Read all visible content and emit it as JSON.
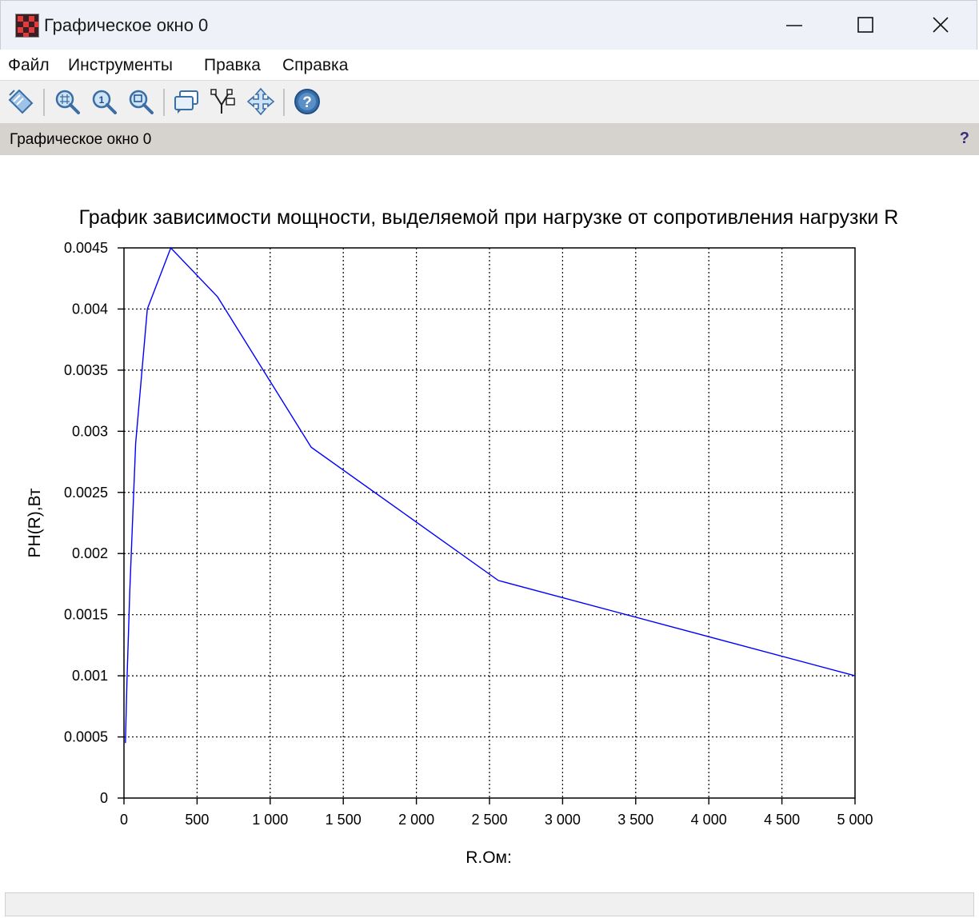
{
  "window": {
    "title": "Графическое окно 0"
  },
  "menu": {
    "items": [
      "Файл",
      "Инструменты",
      "Правка",
      "Справка"
    ]
  },
  "toolbar": {
    "buttons": [
      "datatip-icon",
      "zoom-grid-icon",
      "zoom-100-icon",
      "zoom-area-icon",
      "rotate-icon",
      "datatip-manager-icon",
      "pan-icon",
      "help-icon"
    ]
  },
  "panel": {
    "title": "Графическое окно 0",
    "help": "?"
  },
  "colors": {
    "series": "#0000ff",
    "grid": "#000000",
    "panel": "#d6d3ce",
    "titlebar": "#eef2f8"
  },
  "chart_data": {
    "type": "line",
    "title": "График зависимости мощности, выделяемой при нагрузке от сопротивления нагрузки R",
    "xlabel": "R.Ом:",
    "ylabel": "PH(R),Вт",
    "xlim": [
      0,
      5000
    ],
    "ylim": [
      0,
      0.0045
    ],
    "xticks": [
      0,
      500,
      1000,
      1500,
      2000,
      2500,
      3000,
      3500,
      4000,
      4500,
      5000
    ],
    "xtick_labels": [
      "0",
      "500",
      "1 000",
      "1 500",
      "2 000",
      "2 500",
      "3 000",
      "3 500",
      "4 000",
      "4 500",
      "5 000"
    ],
    "yticks": [
      0,
      0.0005,
      0.001,
      0.0015,
      0.002,
      0.0025,
      0.003,
      0.0035,
      0.004,
      0.0045
    ],
    "ytick_labels": [
      "0",
      "0.0005",
      "0.001",
      "0.0015",
      "0.002",
      "0.0025",
      "0.003",
      "0.0035",
      "0.004",
      "0.0045"
    ],
    "grid": true,
    "series": [
      {
        "x": [
          10,
          20,
          40,
          80,
          160,
          320,
          640,
          1280,
          2560,
          5000
        ],
        "y": [
          0.00045,
          0.00095,
          0.0017,
          0.0029,
          0.004,
          0.0045,
          0.0041,
          0.00287,
          0.00178,
          0.001
        ]
      }
    ]
  }
}
